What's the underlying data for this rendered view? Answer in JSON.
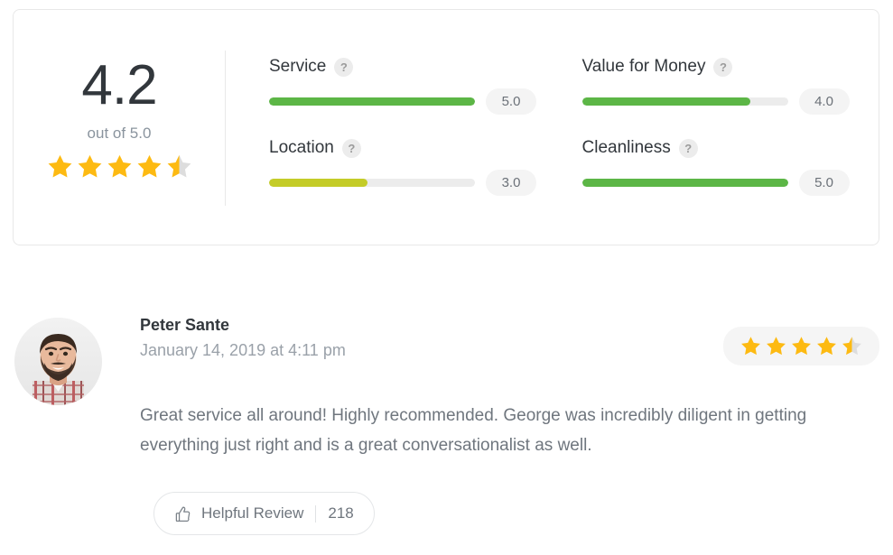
{
  "summary": {
    "score": "4.2",
    "out_of_label": "out of 5.0",
    "stars_value": 4.5,
    "star_color": "#FDBA12",
    "star_empty_color": "#dddddd",
    "help_icon_glyph": "?",
    "metrics": [
      {
        "label": "Service",
        "value": "5.0",
        "percent": 100,
        "color": "#5cb646",
        "help": "?"
      },
      {
        "label": "Value for Money",
        "value": "4.0",
        "percent": 82,
        "color": "#5cb646",
        "help": "?"
      },
      {
        "label": "Location",
        "value": "3.0",
        "percent": 48,
        "color": "#c4cc28",
        "help": "?"
      },
      {
        "label": "Cleanliness",
        "value": "5.0",
        "percent": 100,
        "color": "#5cb646",
        "help": "?"
      }
    ]
  },
  "review": {
    "avatar_alt": "user-avatar",
    "reviewer_name": "Peter Sante",
    "date": "January 14, 2019 at 4:11 pm",
    "rating_value": 4.5,
    "text": "Great service all around! Highly recommended. George was incredibly diligent in getting everything just right and is a great conversationalist as well.",
    "helpful_label": "Helpful Review",
    "helpful_count": "218",
    "thumb_icon": "thumbs-up-icon"
  }
}
